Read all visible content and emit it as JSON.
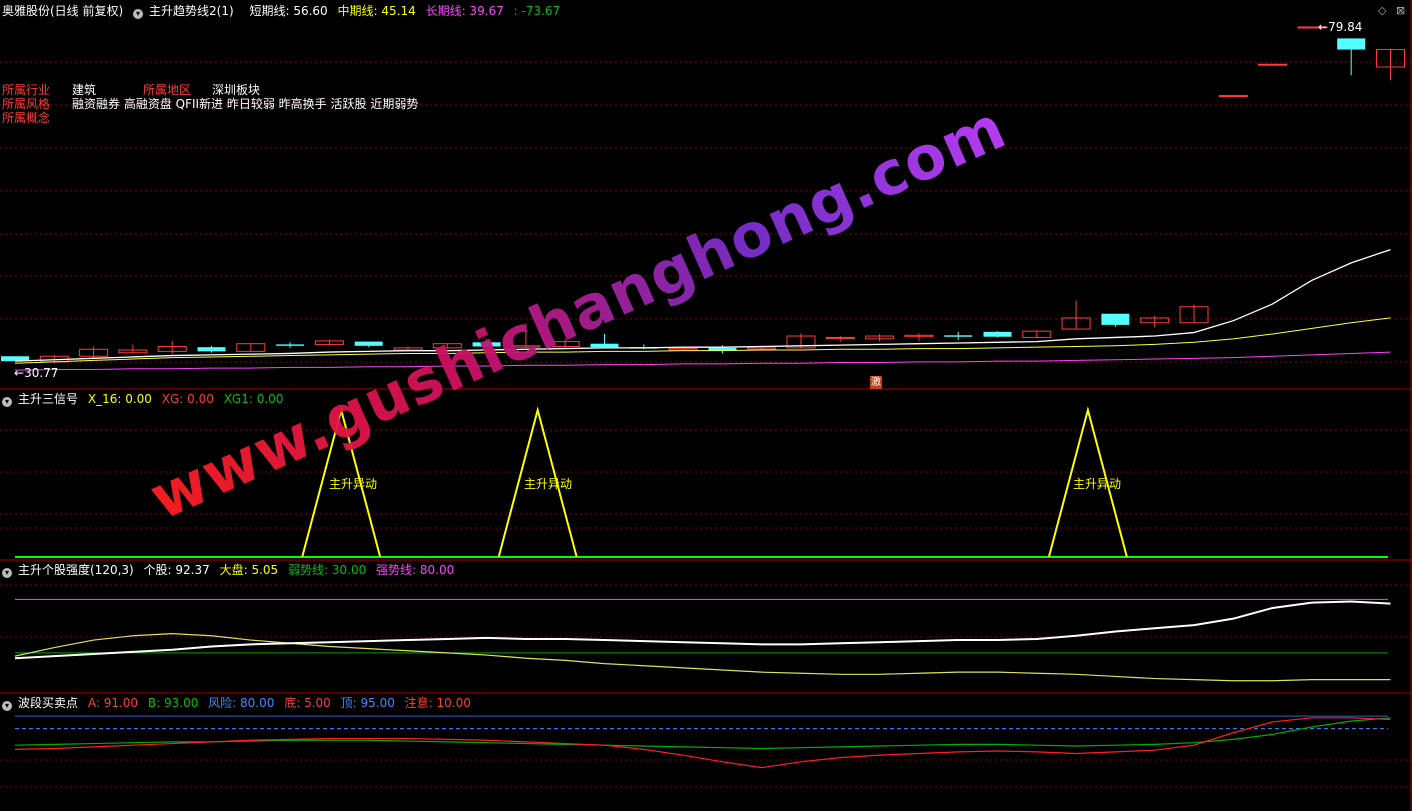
{
  "header": {
    "stock_name": "奥雅股份(日线 前复权)",
    "indicator": "主升趋势线2(1)",
    "short_label": "短期线: 56.60",
    "mid_label": "中期线: 45.14",
    "long_label": "长期线: 39.67",
    "extra_label": ": -73.67"
  },
  "info": {
    "industry_key": "所属行业",
    "industry_val": "建筑",
    "region_key": "所属地区",
    "region_val": "深圳板块",
    "style_key": "所属风格",
    "style_val": "融资融券 高融资盘 QFII新进 昨日较弱 昨高换手 活跃股 近期弱势",
    "concept_key": "所属概念"
  },
  "price_labels": {
    "high": "79.84",
    "low": "30.77"
  },
  "badge": "激",
  "panel2": {
    "title": "主升三信号",
    "x16": "X_16: 0.00",
    "xg": "XG: 0.00",
    "xg1": "XG1: 0.00",
    "signal_label": "主升异动"
  },
  "panel3": {
    "title": "主升个股强度(120,3)",
    "stock": "个股: 92.37",
    "market": "大盘: 5.05",
    "weak": "弱势线: 30.00",
    "strong": "强势线: 80.00"
  },
  "panel4": {
    "title": "波段买卖点",
    "a": "A: 91.00",
    "b": "B: 93.00",
    "risk": "风险: 80.00",
    "bottom": "底: 5.00",
    "top": "顶: 95.00",
    "caution": "注意: 10.00"
  },
  "watermark": "www.gushichanghong.com",
  "colors": {
    "up": "#ff3b3b",
    "down": "#54ffff",
    "short": "#ffffff",
    "mid": "#ffff40",
    "long": "#ff40ff",
    "grid": "#8b0000"
  },
  "chart_data": [
    {
      "type": "candlestick",
      "price_range": [
        30.77,
        79.84
      ],
      "candles": [
        {
          "o": 32.6,
          "c": 31.9,
          "h": 32.6,
          "l": 31.9
        },
        {
          "o": 31.8,
          "c": 32.6,
          "h": 32.8,
          "l": 31.6
        },
        {
          "o": 32.6,
          "c": 33.6,
          "h": 34.0,
          "l": 32.2
        },
        {
          "o": 33.1,
          "c": 33.5,
          "h": 34.3,
          "l": 33.0
        },
        {
          "o": 33.3,
          "c": 34.0,
          "h": 34.8,
          "l": 32.9
        },
        {
          "o": 33.9,
          "c": 33.3,
          "h": 34.1,
          "l": 33.1
        },
        {
          "o": 33.3,
          "c": 34.4,
          "h": 34.5,
          "l": 33.3
        },
        {
          "o": 34.3,
          "c": 34.1,
          "h": 34.6,
          "l": 33.8
        },
        {
          "o": 34.3,
          "c": 34.8,
          "h": 35.0,
          "l": 34.1
        },
        {
          "o": 34.7,
          "c": 34.1,
          "h": 34.7,
          "l": 33.9
        },
        {
          "o": 33.5,
          "c": 33.8,
          "h": 34.0,
          "l": 33.3
        },
        {
          "o": 33.8,
          "c": 34.4,
          "h": 34.4,
          "l": 33.7
        },
        {
          "o": 34.6,
          "c": 34.0,
          "h": 35.0,
          "l": 33.9
        },
        {
          "o": 33.9,
          "c": 34.1,
          "h": 37.3,
          "l": 33.9
        },
        {
          "o": 34.0,
          "c": 34.7,
          "h": 35.1,
          "l": 33.8
        },
        {
          "o": 34.4,
          "c": 33.9,
          "h": 35.8,
          "l": 33.7
        },
        {
          "o": 33.9,
          "c": 33.7,
          "h": 34.3,
          "l": 33.6
        },
        {
          "o": 33.5,
          "c": 33.7,
          "h": 33.9,
          "l": 33.4
        },
        {
          "o": 33.8,
          "c": 33.4,
          "h": 34.2,
          "l": 33.0
        },
        {
          "o": 33.6,
          "c": 33.8,
          "h": 34.1,
          "l": 33.4
        },
        {
          "o": 33.8,
          "c": 35.5,
          "h": 35.9,
          "l": 33.7
        },
        {
          "o": 35.2,
          "c": 35.3,
          "h": 35.5,
          "l": 34.7
        },
        {
          "o": 35.1,
          "c": 35.5,
          "h": 35.8,
          "l": 34.7
        },
        {
          "o": 35.4,
          "c": 35.6,
          "h": 35.9,
          "l": 34.8
        },
        {
          "o": 35.6,
          "c": 35.4,
          "h": 36.1,
          "l": 34.9
        },
        {
          "o": 36.1,
          "c": 35.4,
          "h": 36.2,
          "l": 35.3
        },
        {
          "o": 35.3,
          "c": 36.2,
          "h": 36.3,
          "l": 35.2
        },
        {
          "o": 36.5,
          "c": 38.1,
          "h": 40.6,
          "l": 36.5
        },
        {
          "o": 38.7,
          "c": 37.1,
          "h": 38.7,
          "l": 36.8
        },
        {
          "o": 37.4,
          "c": 38.1,
          "h": 38.4,
          "l": 36.8
        },
        {
          "o": 37.4,
          "c": 39.7,
          "h": 40.0,
          "l": 37.4
        },
        {
          "o": 70.0,
          "c": 70.0,
          "h": 70.0,
          "l": 70.0
        },
        {
          "o": 74.5,
          "c": 74.5,
          "h": 74.5,
          "l": 74.5
        },
        {
          "o": 79.84,
          "c": 79.84,
          "h": 79.84,
          "l": 79.84
        },
        {
          "o": 78.2,
          "c": 76.6,
          "h": 78.2,
          "l": 72.9
        },
        {
          "o": 74.1,
          "c": 76.6,
          "h": 76.6,
          "l": 72.2
        }
      ],
      "short_line": [
        31.9,
        32.1,
        32.3,
        32.5,
        32.7,
        32.8,
        32.9,
        33.0,
        33.2,
        33.3,
        33.4,
        33.4,
        33.5,
        33.6,
        33.7,
        33.8,
        33.8,
        33.9,
        33.9,
        34.0,
        34.1,
        34.2,
        34.3,
        34.4,
        34.5,
        34.6,
        34.7,
        35.1,
        35.3,
        35.5,
        36.0,
        37.7,
        40.1,
        43.5,
        46.0,
        47.9
      ],
      "mid_line": [
        31.6,
        31.8,
        32.0,
        32.2,
        32.4,
        32.5,
        32.6,
        32.7,
        32.8,
        32.9,
        33.0,
        33.0,
        33.1,
        33.2,
        33.2,
        33.3,
        33.3,
        33.4,
        33.4,
        33.5,
        33.5,
        33.6,
        33.6,
        33.7,
        33.7,
        33.8,
        33.9,
        34.0,
        34.1,
        34.3,
        34.6,
        35.1,
        35.8,
        36.6,
        37.4,
        38.1
      ],
      "long_line": [
        30.6,
        30.7,
        30.7,
        30.8,
        30.8,
        30.9,
        30.9,
        31.0,
        31.0,
        31.1,
        31.1,
        31.2,
        31.2,
        31.3,
        31.3,
        31.4,
        31.4,
        31.5,
        31.5,
        31.6,
        31.6,
        31.7,
        31.7,
        31.8,
        31.8,
        31.9,
        31.9,
        32.0,
        32.1,
        32.2,
        32.3,
        32.4,
        32.6,
        32.8,
        33.0,
        33.2
      ]
    },
    {
      "type": "line",
      "series_labels": [
        "X_16",
        "XG",
        "XG1"
      ],
      "signal_peaks": [
        8.3,
        13.3,
        27.3
      ],
      "y_range": [
        0,
        100
      ]
    },
    {
      "type": "line",
      "y_range": [
        0,
        100
      ],
      "series": [
        {
          "name": "个股",
          "values": [
            25,
            27,
            29,
            31,
            33,
            36,
            38,
            39,
            40,
            41,
            42,
            43,
            44,
            43,
            43,
            42,
            41,
            40,
            39,
            38,
            38,
            39,
            40,
            41,
            42,
            42,
            43,
            46,
            50,
            53,
            56,
            62,
            72,
            77,
            78,
            76
          ]
        },
        {
          "name": "大盘",
          "values": [
            27,
            35,
            42,
            46,
            48,
            46,
            42,
            39,
            36,
            34,
            32,
            30,
            28,
            25,
            23,
            20,
            18,
            16,
            14,
            12,
            11,
            10,
            10,
            11,
            12,
            12,
            11,
            10,
            8,
            6,
            5,
            4,
            4,
            5,
            5,
            5
          ]
        },
        {
          "name": "弱势线",
          "values": [
            30,
            30
          ]
        },
        {
          "name": "强势线",
          "values": [
            80,
            80
          ]
        }
      ]
    },
    {
      "type": "line",
      "y_range": [
        0,
        100
      ],
      "series": [
        {
          "name": "A",
          "values": [
            55,
            56,
            58,
            60,
            62,
            64,
            66,
            67,
            68,
            68,
            68,
            67,
            66,
            64,
            62,
            60,
            55,
            48,
            40,
            33,
            40,
            45,
            48,
            50,
            52,
            53,
            52,
            50,
            52,
            54,
            60,
            75,
            88,
            93,
            93,
            91
          ]
        },
        {
          "name": "B",
          "values": [
            60,
            61,
            62,
            63,
            64,
            64,
            65,
            66,
            66,
            66,
            65,
            64,
            63,
            62,
            61,
            60,
            59,
            58,
            57,
            56,
            57,
            58,
            59,
            60,
            61,
            61,
            60,
            59,
            60,
            61,
            63,
            67,
            73,
            82,
            89,
            93
          ]
        },
        {
          "name": "风险",
          "values": [
            80,
            80
          ]
        },
        {
          "name": "底",
          "values": [
            5,
            5
          ]
        },
        {
          "name": "顶",
          "values": [
            95,
            95
          ]
        },
        {
          "name": "注意",
          "values": [
            10,
            10
          ]
        }
      ]
    }
  ]
}
